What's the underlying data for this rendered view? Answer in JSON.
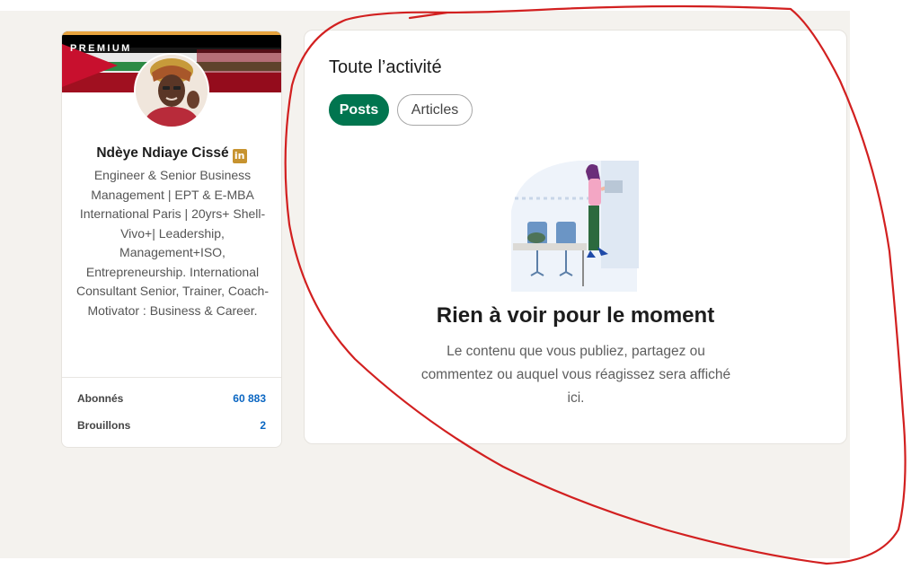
{
  "profile": {
    "premium_label": "PREMIUM",
    "name": "Ndèye Ndiaye Cissé",
    "badge_icon": "linkedin-icon",
    "headline": "Engineer & Senior Business Management | EPT & E-MBA International Paris | 20yrs+ Shell-Vivo+| Leadership, Management+ISO, Entrepreneurship. International Consultant Senior, Trainer, Coach-Motivator : Business & Career.",
    "stats": [
      {
        "label": "Abonnés",
        "value": "60 883"
      },
      {
        "label": "Brouillons",
        "value": "2"
      }
    ]
  },
  "activity": {
    "title": "Toute l’activité",
    "tabs": [
      {
        "label": "Posts",
        "active": true
      },
      {
        "label": "Articles",
        "active": false
      }
    ],
    "empty_state": {
      "title": "Rien à voir pour le moment",
      "description": "Le contenu que vous publiez, partagez ou commentez ou auquel vous réagissez sera affiché ici."
    }
  },
  "colors": {
    "accent_green": "#01754f",
    "link_blue": "#0a66c2",
    "annotation_red": "#d22020",
    "premium_gold": "#c7932f"
  }
}
